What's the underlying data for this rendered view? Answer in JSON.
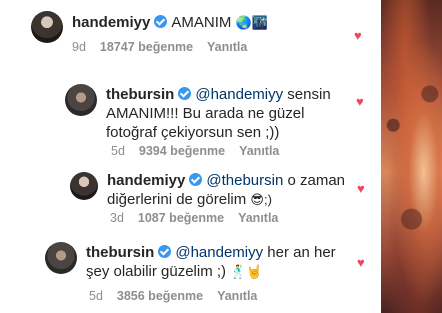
{
  "comments": [
    {
      "username": "handemiyy",
      "body": "AMANIM",
      "emoji": "🌏🌃",
      "time": "9d",
      "likes": "18747 beğenme",
      "reply": "Yanıtla"
    },
    {
      "username": "thebursin",
      "mention": "@handemiyy",
      "body_line1": "sensin",
      "body_line2": "AMANIM!!! Bu arada ne güzel",
      "body_line3": "fotoğraf çekiyorsun sen ;))",
      "time": "5d",
      "likes": "9394 beğenme",
      "reply": "Yanıtla"
    },
    {
      "username": "handemiyy",
      "mention": "@thebursin",
      "body_line1": "o zaman",
      "body_line2": "diğerlerini de görelim",
      "emoji": "😎;)",
      "time": "3d",
      "likes": "1087 beğenme",
      "reply": "Yanıtla"
    },
    {
      "username": "thebursin",
      "mention": "@handemiyy",
      "body_line1": "her an her",
      "body_line2": "şey olabilir güzelim ;)",
      "emoji": "🕺🤘",
      "time": "5d",
      "likes": "3856 beğenme",
      "reply": "Yanıtla"
    }
  ],
  "colors": {
    "verified": "#3897f0",
    "heart": "#ed4956",
    "mention": "#003569",
    "meta": "#8e8e8e"
  },
  "icons": [
    "verified-badge-icon",
    "heart-icon"
  ]
}
